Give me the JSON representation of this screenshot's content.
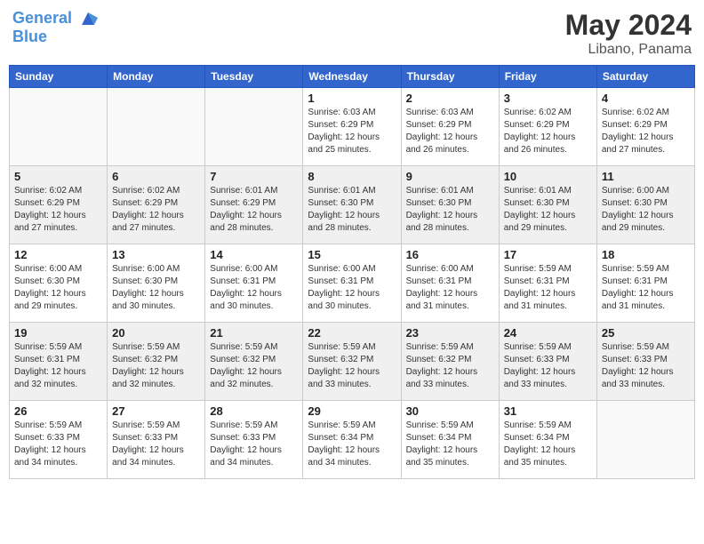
{
  "header": {
    "logo_line1": "General",
    "logo_line2": "Blue",
    "month_year": "May 2024",
    "location": "Libano, Panama"
  },
  "days_of_week": [
    "Sunday",
    "Monday",
    "Tuesday",
    "Wednesday",
    "Thursday",
    "Friday",
    "Saturday"
  ],
  "weeks": [
    [
      {
        "day": "",
        "sunrise": "",
        "sunset": "",
        "daylight": ""
      },
      {
        "day": "",
        "sunrise": "",
        "sunset": "",
        "daylight": ""
      },
      {
        "day": "",
        "sunrise": "",
        "sunset": "",
        "daylight": ""
      },
      {
        "day": "1",
        "sunrise": "Sunrise: 6:03 AM",
        "sunset": "Sunset: 6:29 PM",
        "daylight": "Daylight: 12 hours and 25 minutes."
      },
      {
        "day": "2",
        "sunrise": "Sunrise: 6:03 AM",
        "sunset": "Sunset: 6:29 PM",
        "daylight": "Daylight: 12 hours and 26 minutes."
      },
      {
        "day": "3",
        "sunrise": "Sunrise: 6:02 AM",
        "sunset": "Sunset: 6:29 PM",
        "daylight": "Daylight: 12 hours and 26 minutes."
      },
      {
        "day": "4",
        "sunrise": "Sunrise: 6:02 AM",
        "sunset": "Sunset: 6:29 PM",
        "daylight": "Daylight: 12 hours and 27 minutes."
      }
    ],
    [
      {
        "day": "5",
        "sunrise": "Sunrise: 6:02 AM",
        "sunset": "Sunset: 6:29 PM",
        "daylight": "Daylight: 12 hours and 27 minutes."
      },
      {
        "day": "6",
        "sunrise": "Sunrise: 6:02 AM",
        "sunset": "Sunset: 6:29 PM",
        "daylight": "Daylight: 12 hours and 27 minutes."
      },
      {
        "day": "7",
        "sunrise": "Sunrise: 6:01 AM",
        "sunset": "Sunset: 6:29 PM",
        "daylight": "Daylight: 12 hours and 28 minutes."
      },
      {
        "day": "8",
        "sunrise": "Sunrise: 6:01 AM",
        "sunset": "Sunset: 6:30 PM",
        "daylight": "Daylight: 12 hours and 28 minutes."
      },
      {
        "day": "9",
        "sunrise": "Sunrise: 6:01 AM",
        "sunset": "Sunset: 6:30 PM",
        "daylight": "Daylight: 12 hours and 28 minutes."
      },
      {
        "day": "10",
        "sunrise": "Sunrise: 6:01 AM",
        "sunset": "Sunset: 6:30 PM",
        "daylight": "Daylight: 12 hours and 29 minutes."
      },
      {
        "day": "11",
        "sunrise": "Sunrise: 6:00 AM",
        "sunset": "Sunset: 6:30 PM",
        "daylight": "Daylight: 12 hours and 29 minutes."
      }
    ],
    [
      {
        "day": "12",
        "sunrise": "Sunrise: 6:00 AM",
        "sunset": "Sunset: 6:30 PM",
        "daylight": "Daylight: 12 hours and 29 minutes."
      },
      {
        "day": "13",
        "sunrise": "Sunrise: 6:00 AM",
        "sunset": "Sunset: 6:30 PM",
        "daylight": "Daylight: 12 hours and 30 minutes."
      },
      {
        "day": "14",
        "sunrise": "Sunrise: 6:00 AM",
        "sunset": "Sunset: 6:31 PM",
        "daylight": "Daylight: 12 hours and 30 minutes."
      },
      {
        "day": "15",
        "sunrise": "Sunrise: 6:00 AM",
        "sunset": "Sunset: 6:31 PM",
        "daylight": "Daylight: 12 hours and 30 minutes."
      },
      {
        "day": "16",
        "sunrise": "Sunrise: 6:00 AM",
        "sunset": "Sunset: 6:31 PM",
        "daylight": "Daylight: 12 hours and 31 minutes."
      },
      {
        "day": "17",
        "sunrise": "Sunrise: 5:59 AM",
        "sunset": "Sunset: 6:31 PM",
        "daylight": "Daylight: 12 hours and 31 minutes."
      },
      {
        "day": "18",
        "sunrise": "Sunrise: 5:59 AM",
        "sunset": "Sunset: 6:31 PM",
        "daylight": "Daylight: 12 hours and 31 minutes."
      }
    ],
    [
      {
        "day": "19",
        "sunrise": "Sunrise: 5:59 AM",
        "sunset": "Sunset: 6:31 PM",
        "daylight": "Daylight: 12 hours and 32 minutes."
      },
      {
        "day": "20",
        "sunrise": "Sunrise: 5:59 AM",
        "sunset": "Sunset: 6:32 PM",
        "daylight": "Daylight: 12 hours and 32 minutes."
      },
      {
        "day": "21",
        "sunrise": "Sunrise: 5:59 AM",
        "sunset": "Sunset: 6:32 PM",
        "daylight": "Daylight: 12 hours and 32 minutes."
      },
      {
        "day": "22",
        "sunrise": "Sunrise: 5:59 AM",
        "sunset": "Sunset: 6:32 PM",
        "daylight": "Daylight: 12 hours and 33 minutes."
      },
      {
        "day": "23",
        "sunrise": "Sunrise: 5:59 AM",
        "sunset": "Sunset: 6:32 PM",
        "daylight": "Daylight: 12 hours and 33 minutes."
      },
      {
        "day": "24",
        "sunrise": "Sunrise: 5:59 AM",
        "sunset": "Sunset: 6:33 PM",
        "daylight": "Daylight: 12 hours and 33 minutes."
      },
      {
        "day": "25",
        "sunrise": "Sunrise: 5:59 AM",
        "sunset": "Sunset: 6:33 PM",
        "daylight": "Daylight: 12 hours and 33 minutes."
      }
    ],
    [
      {
        "day": "26",
        "sunrise": "Sunrise: 5:59 AM",
        "sunset": "Sunset: 6:33 PM",
        "daylight": "Daylight: 12 hours and 34 minutes."
      },
      {
        "day": "27",
        "sunrise": "Sunrise: 5:59 AM",
        "sunset": "Sunset: 6:33 PM",
        "daylight": "Daylight: 12 hours and 34 minutes."
      },
      {
        "day": "28",
        "sunrise": "Sunrise: 5:59 AM",
        "sunset": "Sunset: 6:33 PM",
        "daylight": "Daylight: 12 hours and 34 minutes."
      },
      {
        "day": "29",
        "sunrise": "Sunrise: 5:59 AM",
        "sunset": "Sunset: 6:34 PM",
        "daylight": "Daylight: 12 hours and 34 minutes."
      },
      {
        "day": "30",
        "sunrise": "Sunrise: 5:59 AM",
        "sunset": "Sunset: 6:34 PM",
        "daylight": "Daylight: 12 hours and 35 minutes."
      },
      {
        "day": "31",
        "sunrise": "Sunrise: 5:59 AM",
        "sunset": "Sunset: 6:34 PM",
        "daylight": "Daylight: 12 hours and 35 minutes."
      },
      {
        "day": "",
        "sunrise": "",
        "sunset": "",
        "daylight": ""
      }
    ]
  ]
}
